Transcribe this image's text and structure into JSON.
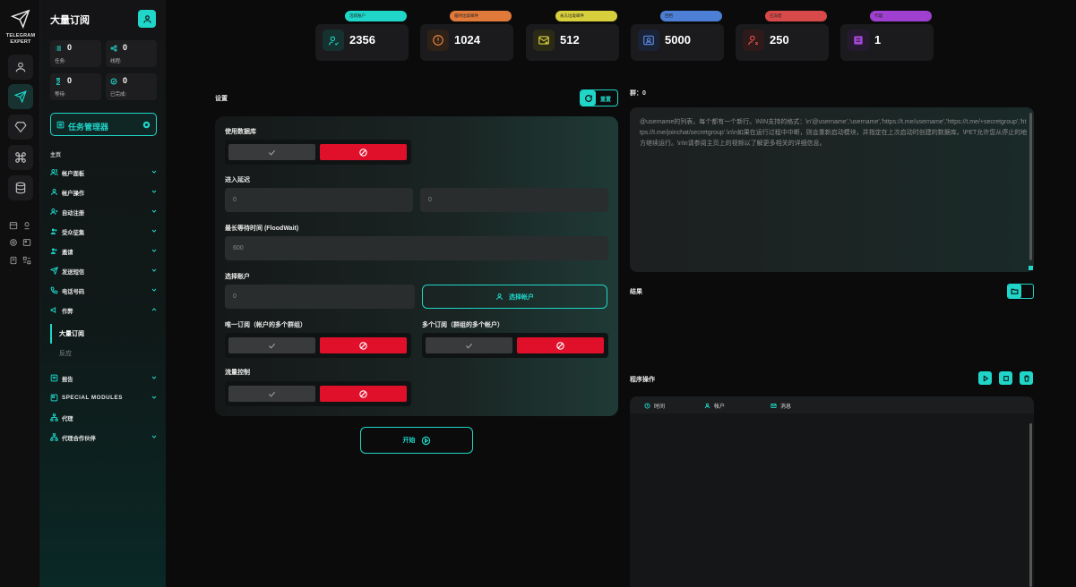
{
  "app": {
    "logo_line1": "TELEGRAM",
    "logo_line2": "EXPERT",
    "accent": "#1fd6c8"
  },
  "sidebar": {
    "title": "大量订阅",
    "stats": [
      {
        "value": "0",
        "label": "任务:"
      },
      {
        "value": "0",
        "label": "线程:"
      },
      {
        "value": "0",
        "label": "等待:"
      },
      {
        "value": "0",
        "label": "已完成:"
      }
    ],
    "task_manager": "任务管理器",
    "section": "主页",
    "nav": [
      {
        "label": "帐户面板"
      },
      {
        "label": "帐户操作"
      },
      {
        "label": "自动注册"
      },
      {
        "label": "受众征集"
      },
      {
        "label": "邀请"
      },
      {
        "label": "发送短信"
      },
      {
        "label": "电话号码"
      },
      {
        "label": "作弊"
      }
    ],
    "sub": [
      "大量订阅",
      "反应"
    ],
    "nav2": [
      {
        "label": "报告"
      },
      {
        "label": "SPECIAL MODULES"
      },
      {
        "label": "代理"
      },
      {
        "label": "代理合作伙伴"
      }
    ]
  },
  "cards": [
    {
      "tag": "活跃账户",
      "value": "2356",
      "color": "#1fd6c8",
      "icon": "user-check-icon"
    },
    {
      "tag": "临时垃圾邮件",
      "value": "1024",
      "color": "#e07a3b",
      "icon": "alert-circle-icon"
    },
    {
      "tag": "永久垃圾邮件",
      "value": "512",
      "color": "#d8cf3d",
      "icon": "mail-x-icon"
    },
    {
      "tag": "回档",
      "value": "5000",
      "color": "#4d7fd6",
      "icon": "id-card-icon"
    },
    {
      "tag": "已冻结",
      "value": "250",
      "color": "#d84a4a",
      "icon": "user-x-icon"
    },
    {
      "tag": "代理",
      "value": "1",
      "color": "#a040d0",
      "icon": "proxy-icon"
    }
  ],
  "settings": {
    "title": "设置",
    "reset": "重置",
    "use_db": "使用数据库",
    "join_delay": "进入延迟",
    "delay_min": "0",
    "delay_max": "0",
    "floodwait_label": "最长等待时间 (FloodWait)",
    "floodwait_value": "600",
    "select_accounts": "选择账户",
    "accounts_value": "0",
    "select_btn": "选择帐户",
    "single_sub": "唯一订阅（帐户的多个群组）",
    "multi_sub": "多个订阅（群组的多个帐户）",
    "flow_control": "流量控制",
    "start": "开始"
  },
  "right": {
    "groups_label": "群：0",
    "placeholder": "@username的列表，每个都有一个新行。\\N\\N支持的格式：\\n'@username','username','https://t.me/username','https://t.me/+secretgroup','https://t.me/joinchat/secretgroup'.\\n\\n如果在运行过程中中断，则会重新启动模块，并指定在上次启动时创建的数据库。\\PET允许您从停止的地方继续运行。\\n\\n请参阅主页上的视频以了解更多相关的详细信息。",
    "results": "结果",
    "program_ops": "程序操作",
    "log_cols": [
      "时间",
      "帐户",
      "消息"
    ]
  }
}
